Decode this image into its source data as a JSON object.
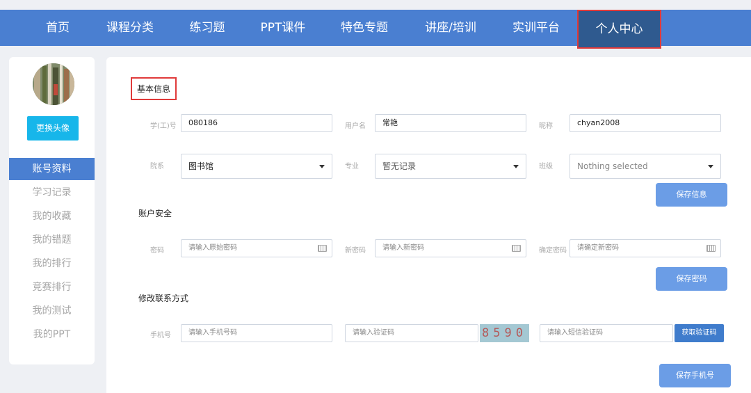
{
  "nav": {
    "items": [
      {
        "label": "首页"
      },
      {
        "label": "课程分类"
      },
      {
        "label": "练习题"
      },
      {
        "label": "PPT课件"
      },
      {
        "label": "特色专题"
      },
      {
        "label": "讲座/培训"
      },
      {
        "label": "实训平台"
      },
      {
        "label": "个人中心"
      }
    ],
    "active_index": 7
  },
  "sidebar": {
    "change_avatar_label": "更换头像",
    "items": [
      {
        "label": "账号资料"
      },
      {
        "label": "学习记录"
      },
      {
        "label": "我的收藏"
      },
      {
        "label": "我的错题"
      },
      {
        "label": "我的排行"
      },
      {
        "label": "竞赛排行"
      },
      {
        "label": "我的测试"
      },
      {
        "label": "我的PPT"
      }
    ]
  },
  "basic": {
    "title": "基本信息",
    "student_id_label": "学(工)号",
    "student_id_value": "080186",
    "username_label": "用户名",
    "username_value": "常艳",
    "nickname_label": "昵称",
    "nickname_value": "chyan2008",
    "dept_label": "院系",
    "dept_value": "图书馆",
    "major_label": "专业",
    "major_value": "暂无记录",
    "class_label": "班级",
    "class_value": "Nothing selected",
    "save_label": "保存信息"
  },
  "security": {
    "title": "账户安全",
    "pwd_label": "密码",
    "pwd_placeholder": "请输入原始密码",
    "new_pwd_label": "新密码",
    "new_pwd_placeholder": "请输入新密码",
    "confirm_label": "确定密码",
    "confirm_placeholder": "请确定新密码",
    "save_label": "保存密码"
  },
  "contact": {
    "title": "修改联系方式",
    "phone_label": "手机号",
    "phone_placeholder": "请输入手机号码",
    "captcha_placeholder": "请输入验证码",
    "captcha_text": "8590",
    "sms_placeholder": "请输入短信验证码",
    "get_code_label": "获取验证码",
    "save_label": "保存手机号"
  },
  "colors": {
    "nav_bg": "#4a7fd1",
    "nav_active": "#2f5a8f",
    "highlight_box": "#e03a3a",
    "avatar_button": "#17b6ea",
    "primary_button": "#6b9de6"
  }
}
